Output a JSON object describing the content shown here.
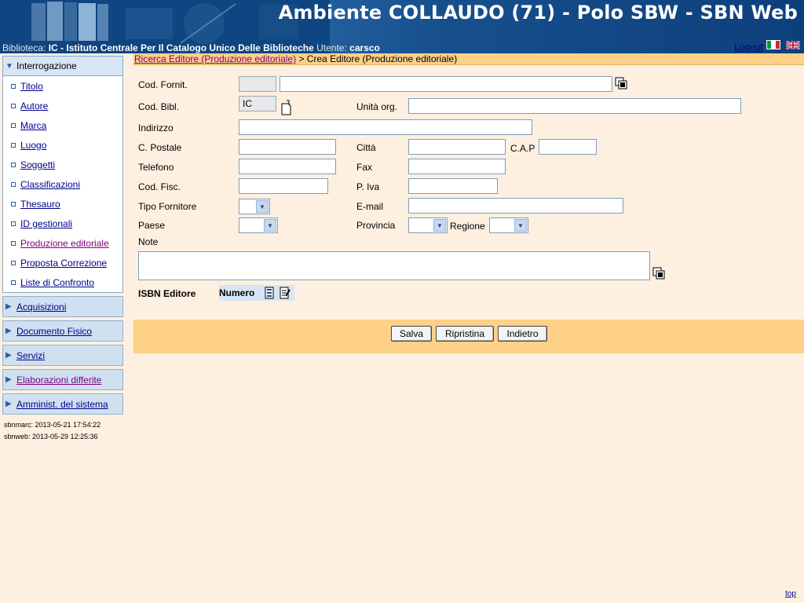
{
  "header": {
    "title": "Ambiente COLLAUDO (71) - Polo SBW - SBN Web",
    "biblioteca_label": "Biblioteca:",
    "biblioteca_value": "IC - Istituto Centrale Per Il Catalogo Unico Delle Biblioteche",
    "utente_label": "Utente:",
    "utente_value": "carsco",
    "logout": "Logout"
  },
  "sidebar": {
    "interrogazione": "Interrogazione",
    "items": [
      {
        "label": "Titolo"
      },
      {
        "label": "Autore"
      },
      {
        "label": "Marca"
      },
      {
        "label": "Luogo"
      },
      {
        "label": "Soggetti"
      },
      {
        "label": "Classificazioni"
      },
      {
        "label": "Thesauro"
      },
      {
        "label": "ID gestionali"
      },
      {
        "label": "Produzione editoriale"
      },
      {
        "label": "Proposta Correzione"
      },
      {
        "label": "Liste di Confronto"
      }
    ],
    "sections": [
      {
        "label": "Acquisizioni"
      },
      {
        "label": "Documento Fisico"
      },
      {
        "label": "Servizi"
      },
      {
        "label": "Elaborazioni differite"
      },
      {
        "label": "Amminist. del sistema"
      }
    ],
    "versions": {
      "sbnmarc": "sbnmarc:  2013-05-21 17:54:22",
      "sbnweb": "sbnweb:   2013-05-29 12:25:36"
    }
  },
  "breadcrumb": {
    "link": "Ricerca Editore (Produzione editoriale)",
    "current": " > Crea Editore (Produzione editoriale)"
  },
  "form": {
    "cod_fornit": "Cod. Fornit.",
    "cod_bibl": "Cod. Bibl.",
    "cod_bibl_value": "IC",
    "unita_org": "Unità org.",
    "indirizzo": "Indirizzo",
    "c_postale": "C. Postale",
    "citta": "Città",
    "cap": "C.A.P",
    "telefono": "Telefono",
    "fax": "Fax",
    "cod_fisc": "Cod. Fisc.",
    "p_iva": "P. Iva",
    "tipo_fornitore": "Tipo Fornitore",
    "email": "E-mail",
    "paese": "Paese",
    "provincia": "Provincia",
    "regione": "Regione",
    "note": "Note",
    "isbn_editore": "ISBN Editore",
    "numero": "Numero"
  },
  "buttons": {
    "salva": "Salva",
    "ripristina": "Ripristina",
    "indietro": "Indietro"
  },
  "footer": {
    "top": "top"
  }
}
